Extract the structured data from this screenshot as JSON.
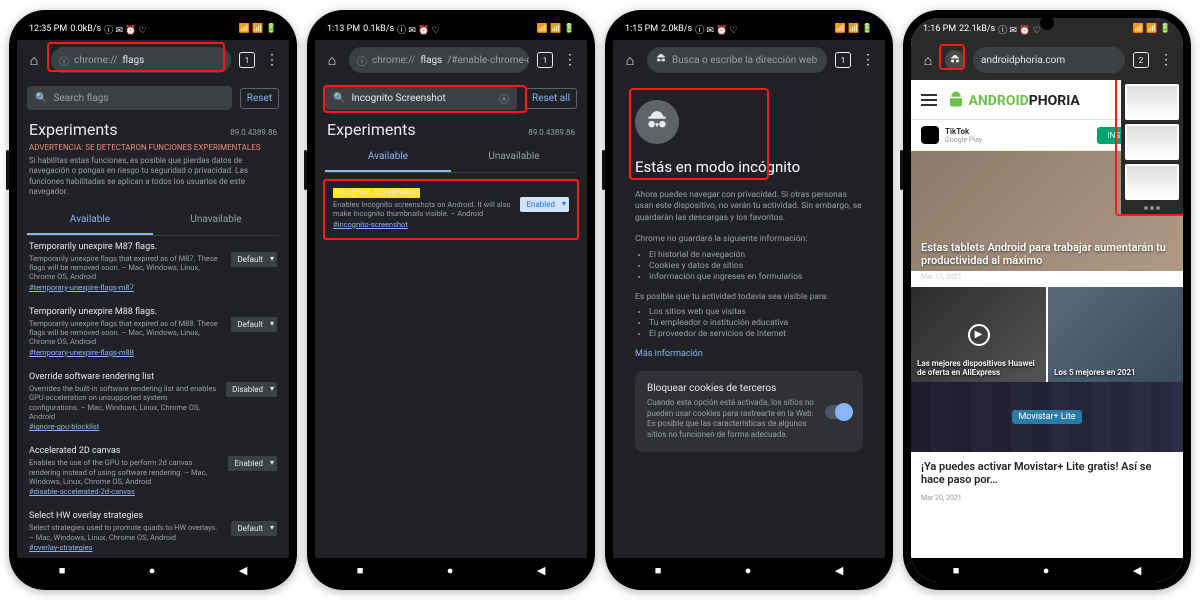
{
  "phones": [
    {
      "status": {
        "time": "12:35 PM",
        "net": "0.0kB/s",
        "icons": "ⓘ ✉ ⏰ ♡",
        "right": "📶 📶 🔋"
      },
      "url_prefix": "chrome://",
      "url_bold": "flags",
      "url_rest": "",
      "tab_count": "1",
      "search_placeholder": "Search flags",
      "reset": "Reset",
      "title": "Experiments",
      "version": "89.0.4389.86",
      "warn": "ADVERTENCIA: SE DETECTARON FUNCIONES EXPERIMENTALES",
      "desc": "Si habilitas estas funciones, es posible que pierdas datos de navegación o pongas en riesgo tu seguridad o privacidad. Las funciones habilitadas se aplican a todos los usuarios de este navegador.",
      "tab_available": "Available",
      "tab_unavailable": "Unavailable",
      "flags": [
        {
          "t": "Temporarily unexpire M87 flags.",
          "d": "Temporarily unexpire flags that expired as of M87. These flags will be removed soon. – Mac, Windows, Linux, Chrome OS, Android",
          "l": "#temporary-unexpire-flags-m87",
          "s": "Default"
        },
        {
          "t": "Temporarily unexpire M88 flags.",
          "d": "Temporarily unexpire flags that expired as of M88. These flags will be removed soon. – Mac, Windows, Linux, Chrome OS, Android",
          "l": "#temporary-unexpire-flags-m88",
          "s": "Default"
        },
        {
          "t": "Override software rendering list",
          "d": "Overrides the built-in software rendering list and enables GPU-acceleration on unsupported system configurations. – Mac, Windows, Linux, Chrome OS, Android",
          "l": "#ignore-gpu-blocklist",
          "s": "Disabled"
        },
        {
          "t": "Accelerated 2D canvas",
          "d": "Enables the use of the GPU to perform 2d canvas rendering instead of using software rendering. – Mac, Windows, Linux, Chrome OS, Android",
          "l": "#disable-accelerated-2d-canvas",
          "s": "Enabled"
        },
        {
          "t": "Select HW overlay strategies",
          "d": "Select strategies used to promote quads to HW overlays. – Mac, Windows, Linux, Chrome OS, Android",
          "l": "#overlay-strategies",
          "s": "Default"
        }
      ]
    },
    {
      "status": {
        "time": "1:13 PM",
        "net": "0.1kB/s",
        "icons": "ⓘ ✉ ⏰ ♡",
        "right": "📶 📶 🔋"
      },
      "url_prefix": "chrome://",
      "url_bold": "flags",
      "url_rest": "/#enable-chrome-duet",
      "tab_count": "1",
      "search_value": "Incognito Screenshot",
      "reset": "Reset all",
      "title": "Experiments",
      "version": "89.0.4389.86",
      "tab_available": "Available",
      "tab_unavailable": "Unavailable",
      "flag": {
        "t": "Incognito Screenshot",
        "d": "Enables Incognito screenshots on Android. It will also make Incognito thumbnails visible. – Android",
        "l": "#incognito-screenshot",
        "s": "Enabled"
      }
    },
    {
      "status": {
        "time": "1:15 PM",
        "net": "2.0kB/s",
        "icons": "ⓘ ✉ ⏰ ♡",
        "right": "📶 📶 🔋"
      },
      "url_placeholder": "Busca o escribe la dirección web",
      "tab_count": "1",
      "title": "Estás en modo incógnito",
      "p1": "Ahora puedes navegar con privacidad. Si otras personas usan este dispositivo, no verán tu actividad. Sin embargo, se guardarán las descargas y los favoritos.",
      "p2": "Chrome no guardará la siguiente información:",
      "ul1": [
        "El historial de navegación",
        "Cookies y datos de sitios",
        "Información que ingreses en formularios"
      ],
      "p3": "Es posible que tu actividad todavía sea visible para:",
      "ul2": [
        "Los sitios web que visitas",
        "Tu empleador o institución educativa",
        "El proveedor de servicios de Internet"
      ],
      "more": "Más información",
      "cookie_t": "Bloquear cookies de terceros",
      "cookie_d": "Cuando esta opción está activada, los sitios no pueden usar cookies para rastrearte en la Web. Es posible que las características de algunos sitios no funcionen de forma adecuada."
    },
    {
      "status": {
        "time": "1:16 PM",
        "net": "22.1kB/s",
        "icons": "ⓘ ✉ ⏰ ♡",
        "right": "📶 📶 🔋"
      },
      "url_host": "androidphoria.com",
      "tab_count": "2",
      "logo_a": "ANDROID",
      "logo_b": "PHORIA",
      "ad_app": "TikTok",
      "ad_sub": "Google Play",
      "ad_btn": "INSTALAR",
      "hero": "Estas tablets Android para trabajar aumentarán tu productividad al máximo",
      "hero_date": "Mar 15, 2021",
      "card1": "Las mejores dispositivos Huawei de oferta en AliExpress",
      "card2": "Los 5 mejores en 2021",
      "mstar": "Movistar+ Lite",
      "art2": "¡Ya puedes activar Movistar+ Lite gratis! Así se hace paso por…",
      "art2_date": "Mar 20, 2021"
    }
  ],
  "nav": {
    "recent": "■",
    "home": "●",
    "back": "◀"
  }
}
